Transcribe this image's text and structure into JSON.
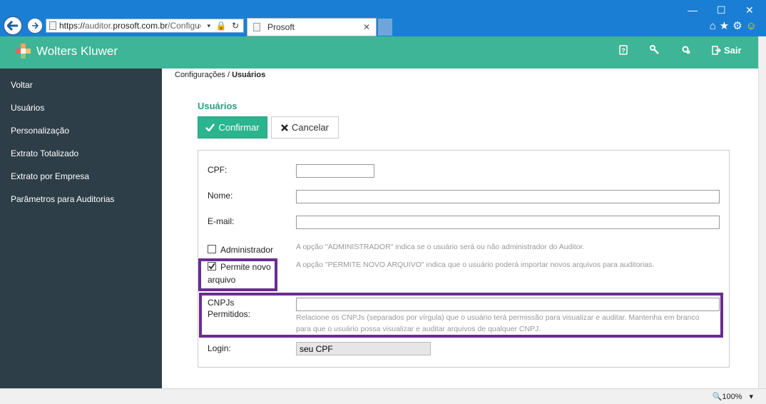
{
  "browser": {
    "url_main": "https://",
    "url_dim1": "auditor.",
    "url_domain": "prosoft.com.br",
    "url_dim2": "/Configu",
    "address_tools": "⌕ ▾ 🔒 ↻",
    "tab_title": "Prosoft",
    "tab_close": "✕",
    "minimize": "—",
    "maximize": "☐",
    "close": "✕",
    "home_icon": "⌂",
    "star_icon": "★",
    "gear_icon": "⚙",
    "smile_icon": "☺"
  },
  "header": {
    "brand": "Wolters Kluwer",
    "help_icon": "?",
    "tools_icon": "🔧",
    "settings_icon": "⚙",
    "logout_label": "Sair",
    "colors": {
      "header_bg": "#3db596",
      "sidebar_bg": "#2e3e48",
      "accent": "#2bb58f",
      "highlight": "#6a2c91"
    }
  },
  "sidebar": {
    "items": [
      {
        "label": "Voltar"
      },
      {
        "label": "Usuários"
      },
      {
        "label": "Personalização"
      },
      {
        "label": "Extrato Totalizado"
      },
      {
        "label": "Extrato por Empresa"
      },
      {
        "label": "Parâmetros para Auditorias"
      }
    ]
  },
  "main": {
    "breadcrumb_parent": "Configurações / ",
    "breadcrumb_current": "Usuários",
    "title": "Usuários",
    "confirm_label": "Confirmar",
    "cancel_label": "Cancelar",
    "form": {
      "cpf_label": "CPF:",
      "cpf_value": "",
      "nome_label": "Nome:",
      "nome_value": "",
      "email_label": "E-mail:",
      "email_value": "",
      "admin_label": "Administrador",
      "admin_checked": false,
      "admin_help": "A opção \"ADMINISTRADOR\" indica se o usuário será ou não administrador do Auditor.",
      "permite_label_1": "Permite novo",
      "permite_label_2": "arquivo",
      "permite_checked": true,
      "permite_help": "A opção \"PERMITE NOVO ARQUIVO\" indica que o usuário poderá importar novos arquivos para auditorias.",
      "cnpjs_label_1": "CNPJs",
      "cnpjs_label_2": "Permitidos:",
      "cnpjs_value": "",
      "cnpjs_help_1": "Relacione os CNPJs (separados por vírgula) que o usuário terá permissão para visualizar e auditar. Mantenha em branco",
      "cnpjs_help_2": "para que o usuário possa visualizar e auditar arquivos de qualquer CNPJ.",
      "login_label": "Login:",
      "login_value": "seu CPF"
    }
  },
  "statusbar": {
    "zoom_label": "100%",
    "zoom_icon": "🔍",
    "dropdown_icon": "▾"
  }
}
